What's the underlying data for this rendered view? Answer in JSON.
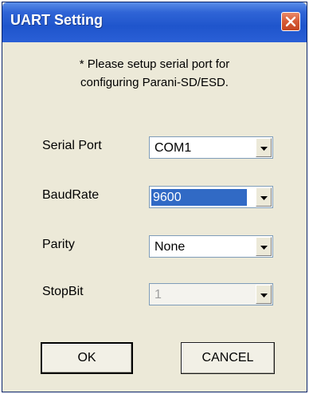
{
  "window": {
    "title": "UART Setting"
  },
  "note": {
    "line1": "* Please setup serial port for",
    "line2": "configuring Parani-SD/ESD."
  },
  "fields": {
    "serial_port": {
      "label": "Serial Port",
      "value": "COM1"
    },
    "baud_rate": {
      "label": "BaudRate",
      "value": "9600"
    },
    "parity": {
      "label": "Parity",
      "value": "None"
    },
    "stop_bit": {
      "label": "StopBit",
      "value": "1"
    }
  },
  "buttons": {
    "ok": "OK",
    "cancel": "CANCEL"
  },
  "icons": {
    "close": "close-icon",
    "dropdown": "chevron-down-icon"
  },
  "colors": {
    "titlebar": "#1f55cc",
    "close_button": "#d65a36",
    "selection": "#316ac5",
    "dialog_bg": "#ece9d8"
  }
}
